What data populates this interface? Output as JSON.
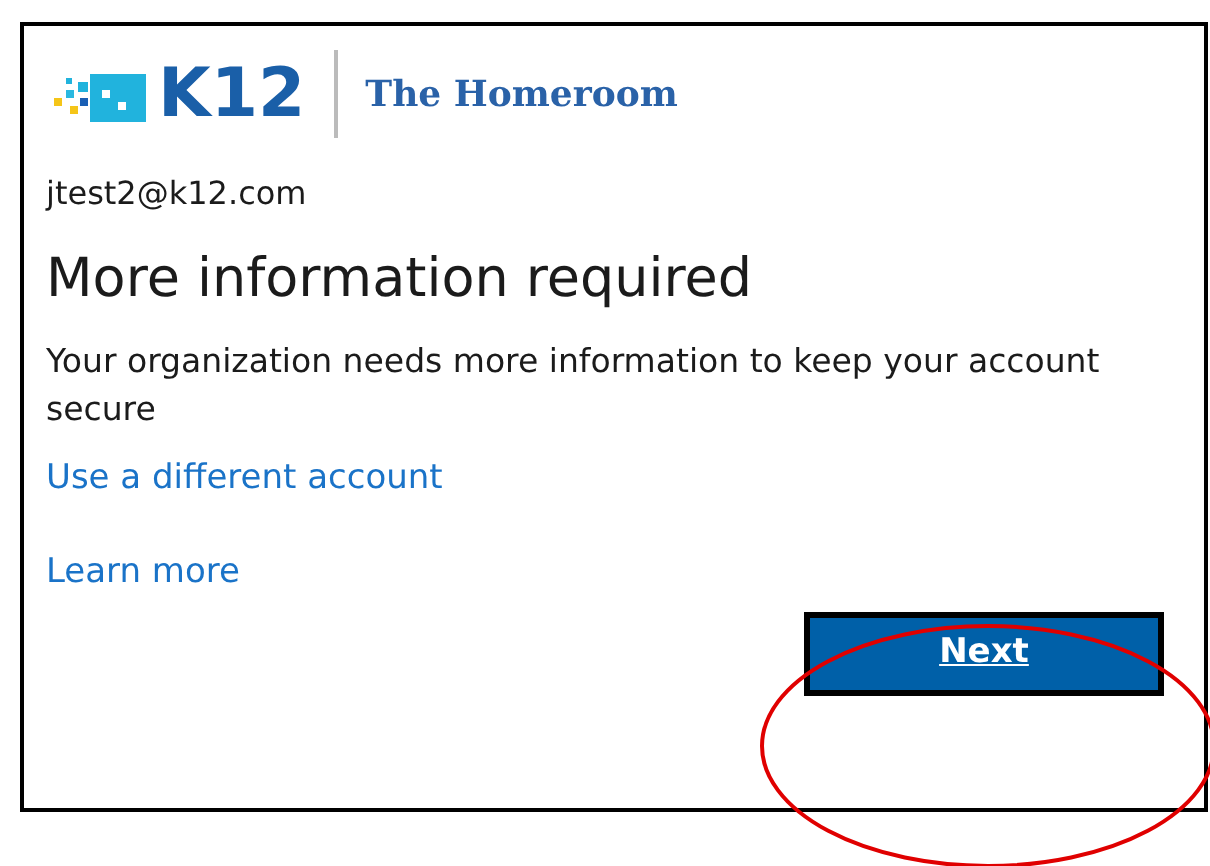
{
  "logo": {
    "brand": "K12",
    "product": "The Homeroom"
  },
  "account": "jtest2@k12.com",
  "title": "More information required",
  "message": "Your organization needs more information to keep your account secure",
  "links": [
    "Use a different account",
    "Learn more"
  ],
  "button": "Next"
}
